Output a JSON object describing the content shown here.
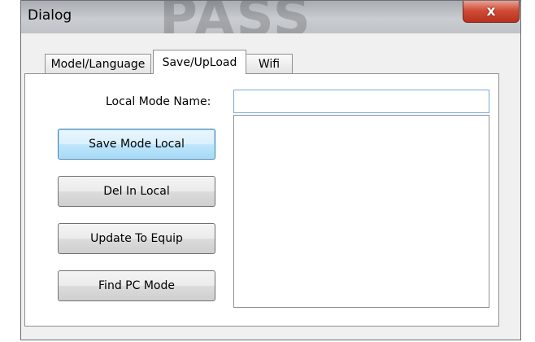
{
  "window": {
    "title": "Dialog",
    "watermark_text": "PASS",
    "close_glyph": "x",
    "close_icon": "close-icon"
  },
  "tabs": [
    {
      "label": "Model/Language",
      "active": false
    },
    {
      "label": "Save/UpLoad",
      "active": true
    },
    {
      "label": "Wifi",
      "active": false
    }
  ],
  "form": {
    "local_mode_name_label": "Local Mode Name:",
    "local_mode_name_value": ""
  },
  "buttons": {
    "save_mode_local": "Save Mode Local",
    "del_in_local": "Del In Local",
    "update_to_equip": "Update To Equip",
    "find_pc_mode": "Find PC Mode"
  },
  "list": {
    "items": []
  },
  "colors": {
    "focus_border": "#3c7fb1",
    "close_button": "#cf4e37",
    "input_border": "#7aa7d8"
  }
}
